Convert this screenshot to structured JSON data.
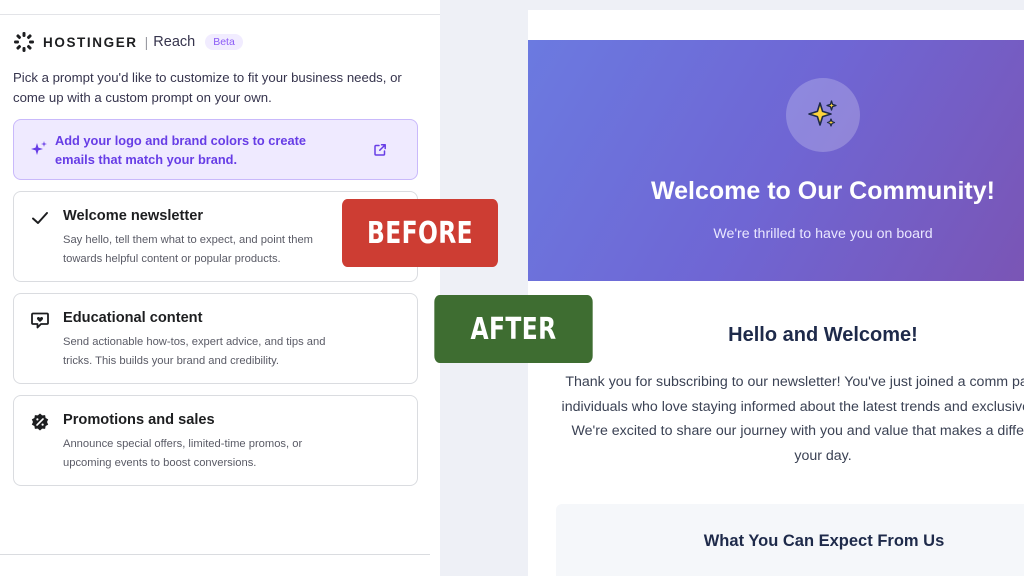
{
  "left": {
    "brand": {
      "name": "HOSTINGER",
      "separator": "|",
      "product": "Reach",
      "badge": "Beta"
    },
    "intro": "Pick a prompt you'd like to customize to fit your business needs, or come up with a custom prompt on your own.",
    "promo": {
      "text": "Add your logo and brand colors to create emails that match your brand.",
      "icon": "sparkle-icon",
      "action_icon": "external-link-icon"
    },
    "cards": [
      {
        "title": "Welcome newsletter",
        "description": "Say hello, tell them what to expect, and point them towards helpful content or popular products.",
        "icon": "check-icon",
        "selected": true
      },
      {
        "title": "Educational content",
        "description": "Send actionable how-tos, expert advice, and tips and tricks. This builds your brand and credibility.",
        "icon": "chat-heart-icon"
      },
      {
        "title": "Promotions and sales",
        "description": "Announce special offers, limited-time promos, or upcoming events to boost conversions.",
        "icon": "discount-badge-icon"
      }
    ]
  },
  "right": {
    "hero": {
      "title": "Welcome to Our Community!",
      "subtitle": "We're thrilled to have you on board",
      "icon": "sparkles-icon"
    },
    "hello": {
      "title": "Hello and Welcome!",
      "body": "Thank you for subscribing to our newsletter! You've just joined a comm passionate individuals who love staying informed about the latest trends and exclusive content. We're excited to share our journey with you and value that makes a difference in your day."
    },
    "expect": {
      "title": "What You Can Expect From Us"
    }
  },
  "labels": {
    "before": "BEFORE",
    "after": "AFTER"
  },
  "colors": {
    "accent": "#673de6",
    "before": "#cd3d33",
    "after": "#3e6d31",
    "hero_start": "#6b7ae0",
    "hero_end": "#7a55b5"
  }
}
